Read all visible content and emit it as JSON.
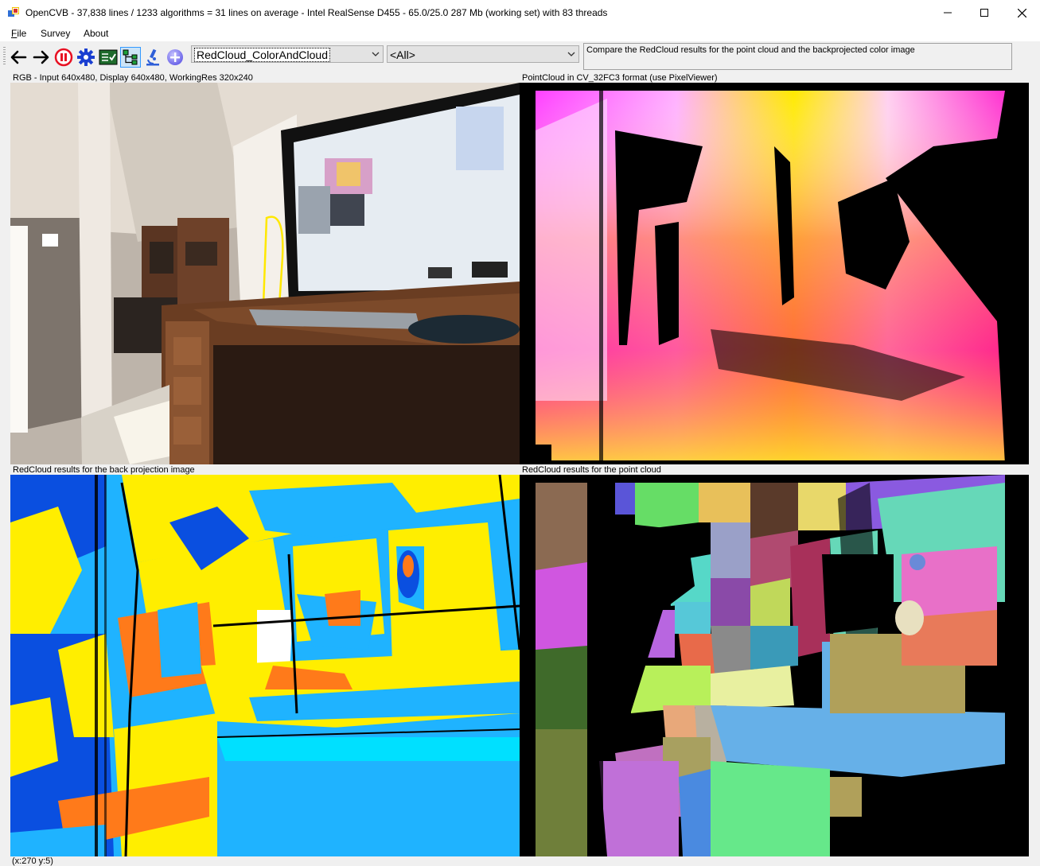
{
  "window": {
    "title": "OpenCVB - 37,838 lines / 1233 algorithms = 31 lines on average - Intel RealSense D455 - 65.0/25.0 287 Mb (working set) with 83 threads"
  },
  "menu": {
    "file": "ile",
    "file_mnemonic": "F",
    "survey": "Survey",
    "about": "About"
  },
  "toolbar": {
    "icons": [
      "back-arrow-icon",
      "forward-arrow-icon",
      "pause-icon",
      "gear-icon",
      "test-all-icon",
      "tree-icon",
      "microscope-icon",
      "add-icon"
    ],
    "algorithm_selected": "RedCloud_ColorAndCloud",
    "group_selected": "<All>",
    "description": "Compare the RedCloud results for the point cloud and the backprojected color image"
  },
  "panels": {
    "top_left_label": "RGB - Input 640x480, Display 640x480, WorkingRes 320x240",
    "top_right_label": "PointCloud in CV_32FC3 format (use PixelViewer)",
    "bottom_left_label": "RedCloud results for the back projection image",
    "bottom_right_label": "RedCloud results for the point cloud"
  },
  "status": {
    "coords": "(x:270 y:5)"
  },
  "colors": {
    "title_bg": "#ffffff",
    "toolbar_bg": "#f0f0f0",
    "pause_red": "#e81123",
    "gear_blue": "#1a3fd1"
  }
}
